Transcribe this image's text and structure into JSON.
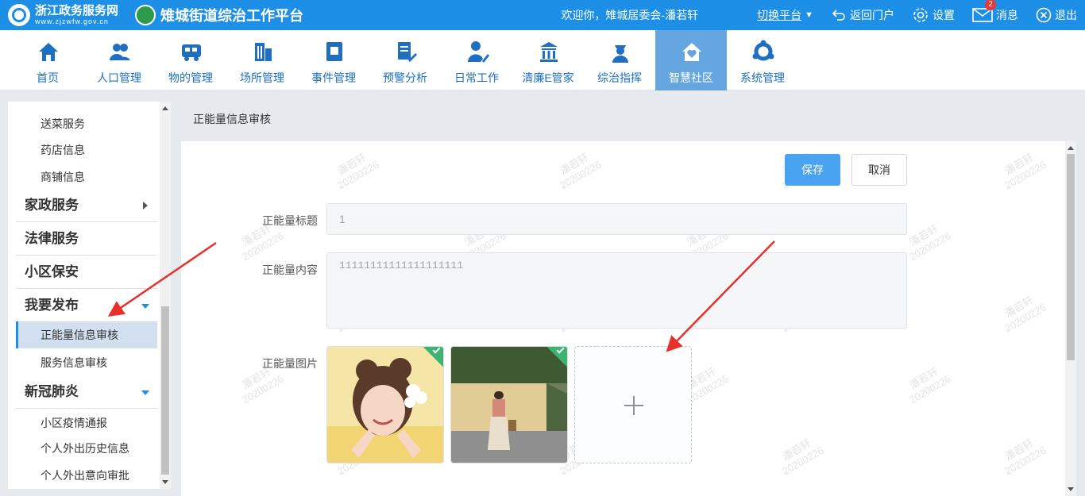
{
  "header": {
    "logo_title": "浙江政务服务网",
    "logo_url": "www.zjzwfw.gov.cn",
    "platform_title": "雉城街道综治工作平台",
    "welcome": "欢迎你，雉城居委会-潘若轩",
    "switch_label": "切换平台",
    "portal_label": "返回门户",
    "settings_label": "设置",
    "message_label": "消息",
    "message_count": "2",
    "logout_label": "退出",
    "brand_color": "#1e8fe6"
  },
  "nav": {
    "items": [
      {
        "label": "首页",
        "icon": "home-icon"
      },
      {
        "label": "人口管理",
        "icon": "people-icon"
      },
      {
        "label": "物的管理",
        "icon": "truck-icon"
      },
      {
        "label": "场所管理",
        "icon": "building-icon"
      },
      {
        "label": "事件管理",
        "icon": "book-icon"
      },
      {
        "label": "预警分析",
        "icon": "report-icon"
      },
      {
        "label": "日常工作",
        "icon": "user-pen-icon"
      },
      {
        "label": "清廉E管家",
        "icon": "temple-icon"
      },
      {
        "label": "综治指挥",
        "icon": "officer-icon"
      },
      {
        "label": "智慧社区",
        "icon": "house-heart-icon"
      },
      {
        "label": "系统管理",
        "icon": "cycle-icon"
      }
    ],
    "active_index": 9
  },
  "sidebar": {
    "items": [
      {
        "label": "送菜服务"
      },
      {
        "label": "药店信息"
      },
      {
        "label": "商铺信息"
      },
      {
        "label": "家政服务"
      },
      {
        "label": "法律服务"
      },
      {
        "label": "小区保安"
      },
      {
        "label": "我要发布"
      },
      {
        "label": "正能量信息审核"
      },
      {
        "label": "服务信息审核"
      },
      {
        "label": "新冠肺炎"
      },
      {
        "label": "小区疫情通报"
      },
      {
        "label": "个人外出历史信息"
      },
      {
        "label": "个人外出意向审批"
      }
    ]
  },
  "main": {
    "breadcrumb": "正能量信息审核",
    "save_label": "保存",
    "cancel_label": "取消",
    "title_label": "正能量标题",
    "title_value": "1",
    "content_label": "正能量内容",
    "content_value": "11111111111111111111",
    "image_label": "正能量图片",
    "watermark_name": "潘若轩",
    "watermark_date": "20200226"
  }
}
